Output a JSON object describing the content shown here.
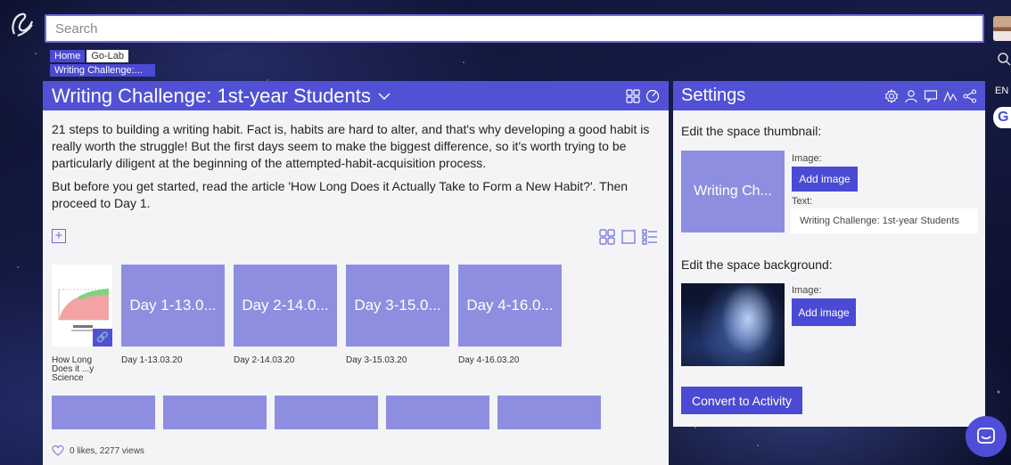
{
  "search": {
    "placeholder": "Search"
  },
  "topbar": {
    "language": "EN"
  },
  "breadcrumb": {
    "home": "Home",
    "golab": "Go-Lab",
    "current": "Writing Challenge:..."
  },
  "space": {
    "title": "Writing Challenge: 1st-year Students",
    "description": [
      "21 steps to building a writing habit. Fact is, habits are hard to alter, and that's why developing a good habit is really worth the struggle! But the first days seem to make the biggest difference, so it's worth trying to be particularly diligent at the beginning of the attempted-habit-acquisition process.",
      "But before you get started, read the article 'How Long Does it Actually Take to Form a New Habit?'. Then proceed to Day 1."
    ],
    "resource": {
      "caption": "How Long Does it ...y Science"
    },
    "tiles": [
      {
        "label": "Day 1-13.0...",
        "caption": "Day 1-13.03.20"
      },
      {
        "label": "Day 2-14.0...",
        "caption": "Day 2-14.03.20"
      },
      {
        "label": "Day 3-15.0...",
        "caption": "Day 3-15.03.20"
      },
      {
        "label": "Day 4-16.0...",
        "caption": "Day 4-16.03.20"
      }
    ],
    "stats": "0 likes, 2277 views"
  },
  "settings": {
    "title": "Settings",
    "thumbnail_heading": "Edit the space thumbnail:",
    "thumbnail_label": "Writing Ch...",
    "image_label": "Image:",
    "add_image": "Add image",
    "text_label": "Text:",
    "text_value": "Writing Challenge: 1st-year Students",
    "background_heading": "Edit the space background:",
    "convert": "Convert to Activity"
  }
}
